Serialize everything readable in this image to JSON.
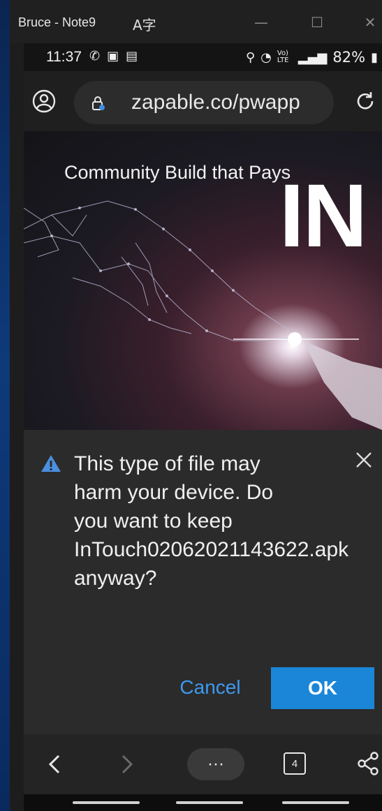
{
  "window": {
    "title": "Bruce - Note9",
    "translate_icon_glyph": "A字"
  },
  "status_bar": {
    "time": "11:37",
    "battery": "82%",
    "network": "Vo) LTE"
  },
  "browser": {
    "url": "zapable.co/pwapp"
  },
  "hero": {
    "headline": "Community Build that Pays",
    "big_text": "IN"
  },
  "dialog": {
    "message": "This type of file may harm your device. Do you want to keep InTouch02062021143622.apk anyway?",
    "cancel_label": "Cancel",
    "ok_label": "OK"
  },
  "navbar": {
    "more_label": "···",
    "tab_count": "4"
  },
  "colors": {
    "accent": "#1b86d8",
    "link": "#3d9af0",
    "warning": "#4a8fe0"
  }
}
